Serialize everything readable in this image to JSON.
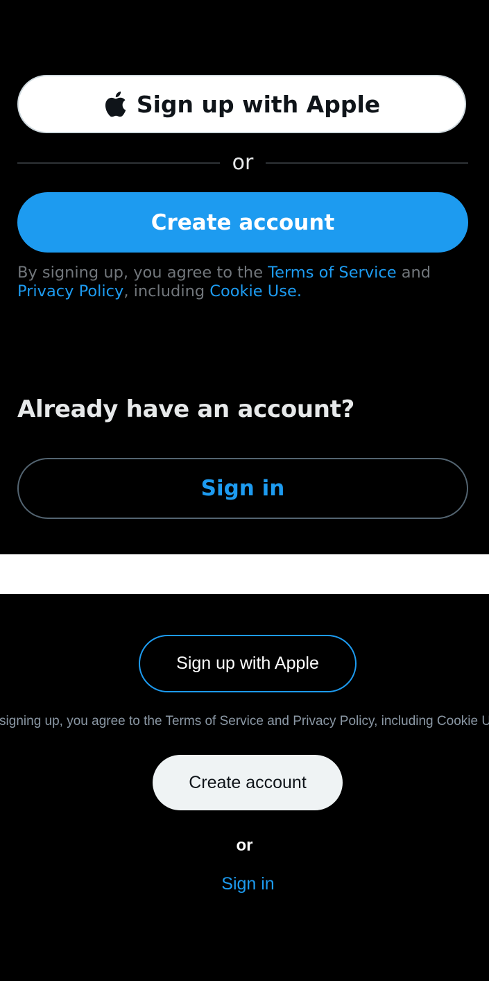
{
  "top": {
    "apple_button_label": "Sign up with Apple",
    "divider_label": "or",
    "create_account_label": "Create account",
    "legal": {
      "prefix": "By signing up, you agree to the ",
      "terms_link": "Terms of Service",
      "and": " and",
      "privacy_link": "Privacy Policy",
      "including": ", including ",
      "cookie_link": "Cookie Use."
    },
    "already_heading": "Already have an account?",
    "sign_in_label": "Sign in"
  },
  "bottom": {
    "apple_button_label": "Sign up with Apple",
    "legal_text": "By signing up, you agree to the Terms of Service and Privacy Policy, including Cookie Use.",
    "create_account_label": "Create account",
    "or_label": "or",
    "sign_in_label": "Sign in"
  },
  "icons": {
    "apple": "apple-icon"
  },
  "colors": {
    "accent": "#1d9bf0",
    "background": "#000000",
    "separator": "#ffffff",
    "muted_text": "#71767b"
  }
}
